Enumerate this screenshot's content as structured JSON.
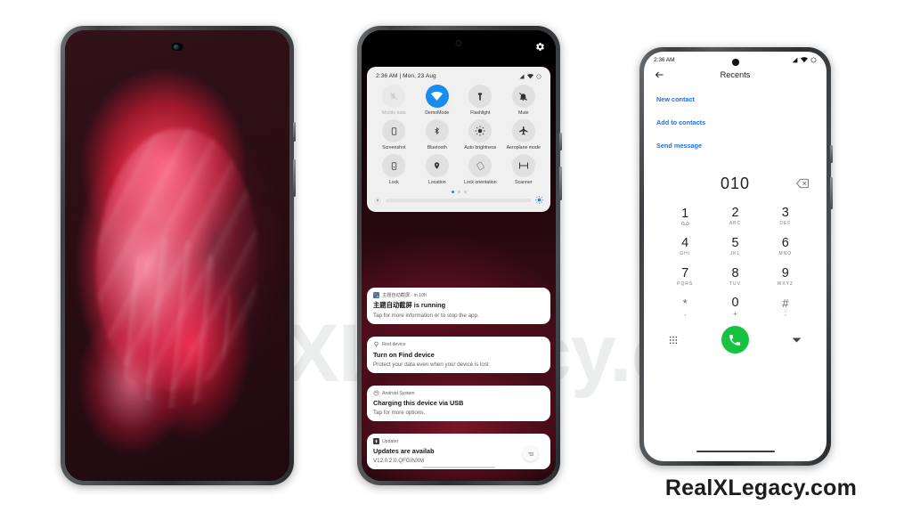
{
  "watermarks": {
    "background": "RealXLegacy.com",
    "corner": "RealXLegacy.com"
  },
  "phone1": {
    "name": "home-screen-wallpaper",
    "description": "Red abstract swirl wallpaper"
  },
  "phone2": {
    "statusbar": {
      "time_date": "2:36 AM | Mon, 23 Aug"
    },
    "quick_settings": {
      "tiles": [
        {
          "label": "Mobile data",
          "icon": "mobile-data-off-icon",
          "state": "disabled"
        },
        {
          "label": "DemoMode",
          "icon": "wifi-icon",
          "state": "on"
        },
        {
          "label": "Flashlight",
          "icon": "flashlight-icon",
          "state": "off"
        },
        {
          "label": "Mute",
          "icon": "bell-mute-icon",
          "state": "off"
        },
        {
          "label": "Screenshot",
          "icon": "screenshot-icon",
          "state": "off"
        },
        {
          "label": "Bluetooth",
          "icon": "bluetooth-icon",
          "state": "off"
        },
        {
          "label": "Auto brightness",
          "icon": "auto-brightness-icon",
          "state": "off"
        },
        {
          "label": "Aeroplane mode",
          "icon": "aeroplane-icon",
          "state": "off"
        },
        {
          "label": "Lock",
          "icon": "lock-icon",
          "state": "off"
        },
        {
          "label": "Location",
          "icon": "location-pin-icon",
          "state": "off"
        },
        {
          "label": "Lock orientation",
          "icon": "rotate-lock-icon",
          "state": "off"
        },
        {
          "label": "Scanner",
          "icon": "scanner-icon",
          "state": "off"
        }
      ],
      "page_dots": 3,
      "active_page": 1,
      "brightness_percent": 100
    },
    "notifications": [
      {
        "app": "主题自动截屏 · in 10h",
        "title": "主题自动截屏 is running",
        "body": "Tap for more information or to stop the app.",
        "icon": "app-icon"
      },
      {
        "app": "Find device",
        "title": "Turn on Find device",
        "body": "Protect your data even when your device is lost",
        "icon": "find-device-icon"
      },
      {
        "app": "Android System",
        "title": "Charging this device via USB",
        "body": "Tap for more options.",
        "icon": "android-system-icon"
      },
      {
        "app": "Updater",
        "title": "Updates are availab",
        "body": "V12.0.2.0.QFGINXM",
        "icon": "updater-icon"
      }
    ]
  },
  "phone3": {
    "statusbar": {
      "time": "2:36 AM"
    },
    "appbar": {
      "title": "Recents",
      "back_icon": "arrow-left-icon"
    },
    "actions": [
      {
        "label": "New contact"
      },
      {
        "label": "Add to contacts"
      },
      {
        "label": "Send message"
      }
    ],
    "dialer": {
      "number": "010",
      "keys": [
        {
          "digit": "1",
          "sub": ""
        },
        {
          "digit": "2",
          "sub": "ABC"
        },
        {
          "digit": "3",
          "sub": "DEF"
        },
        {
          "digit": "4",
          "sub": "GHI"
        },
        {
          "digit": "5",
          "sub": "JKL"
        },
        {
          "digit": "6",
          "sub": "MNO"
        },
        {
          "digit": "7",
          "sub": "PQRS"
        },
        {
          "digit": "8",
          "sub": "TUV"
        },
        {
          "digit": "9",
          "sub": "WXYZ"
        },
        {
          "digit": "*",
          "sub": ","
        },
        {
          "digit": "0",
          "sub": "+"
        },
        {
          "digit": "#",
          "sub": ";"
        }
      ]
    },
    "colors": {
      "accent": "#1a73e8",
      "call": "#16c340"
    }
  }
}
